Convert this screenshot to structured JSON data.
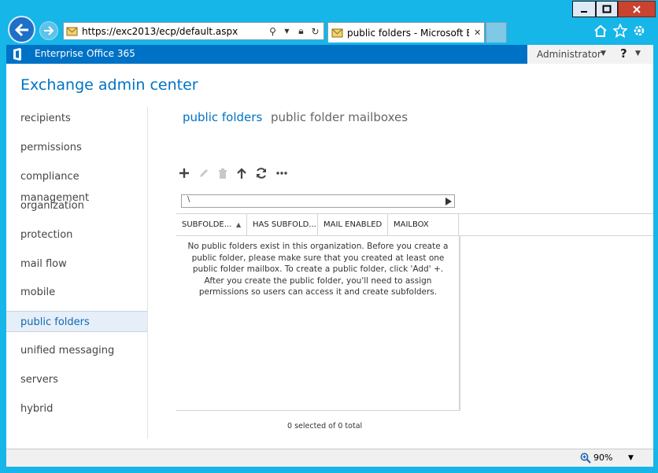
{
  "browser": {
    "address": "https://exc2013/ecp/default.aspx",
    "tab_title": "public folders - Microsoft E...",
    "tab_close": "✕",
    "zoom": "90%"
  },
  "topbar": {
    "links": [
      "Enterprise",
      "Office 365"
    ],
    "user": "Administrator",
    "help": "?"
  },
  "app": {
    "title": "Exchange admin center"
  },
  "sidebar": {
    "items": [
      {
        "label": "recipients"
      },
      {
        "label": "permissions"
      },
      {
        "label": "compliance management"
      },
      {
        "label": "organization"
      },
      {
        "label": "protection"
      },
      {
        "label": "mail flow"
      },
      {
        "label": "mobile"
      },
      {
        "label": "public folders",
        "active": true
      },
      {
        "label": "unified messaging"
      },
      {
        "label": "servers"
      },
      {
        "label": "hybrid"
      }
    ]
  },
  "main": {
    "tabs": [
      "public folders",
      "public folder mailboxes"
    ],
    "toolbar": [
      {
        "name": "add-icon",
        "enabled": true
      },
      {
        "name": "edit-icon",
        "enabled": false
      },
      {
        "name": "delete-icon",
        "enabled": false
      },
      {
        "name": "move-up-icon",
        "enabled": true
      },
      {
        "name": "refresh-icon",
        "enabled": true
      },
      {
        "name": "more-icon",
        "enabled": true
      }
    ],
    "path": "\\",
    "columns": [
      "SUBFOLDE...",
      "HAS SUBFOLD...",
      "MAIL ENABLED",
      "MAILBOX"
    ],
    "empty_message": "No public folders exist in this organization. Before you create a public folder, please make sure that you created at least one public folder mailbox. To create a public folder, click 'Add' +. After you create the public folder, you'll need to assign permissions so users can access it and create subfolders.",
    "selection_count": "0 selected of 0 total"
  },
  "colors": {
    "accent": "#0072c6",
    "chrome": "#16b6e8",
    "active_nav_bg": "#e6eef7"
  }
}
